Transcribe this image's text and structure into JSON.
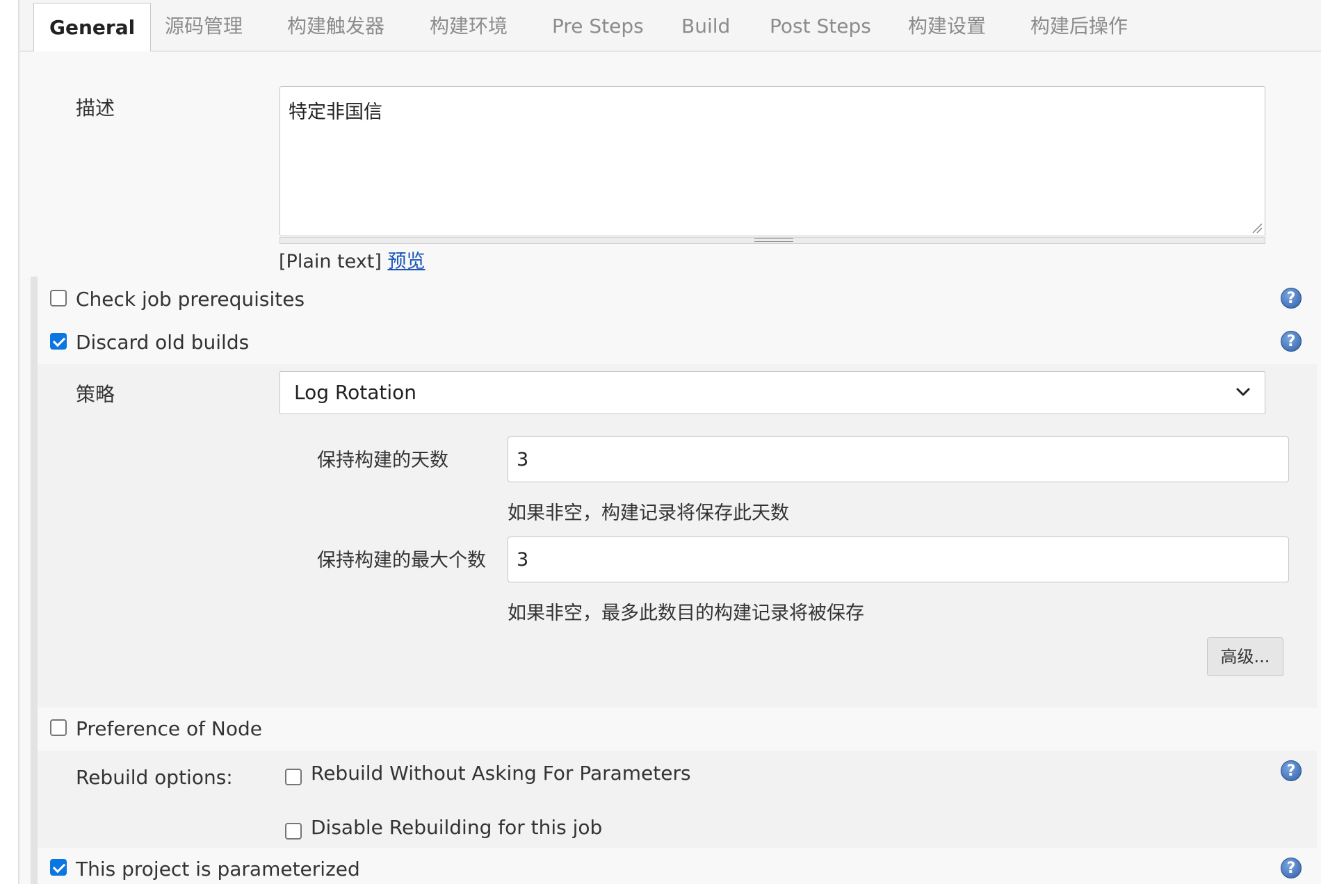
{
  "tabs": [
    {
      "label": "General"
    },
    {
      "label": "源码管理"
    },
    {
      "label": "构建触发器"
    },
    {
      "label": "构建环境"
    },
    {
      "label": "Pre Steps"
    },
    {
      "label": "Build"
    },
    {
      "label": "Post Steps"
    },
    {
      "label": "构建设置"
    },
    {
      "label": "构建后操作"
    }
  ],
  "description": {
    "label": "描述",
    "value": "特定非国信",
    "format_note": "[Plain text]",
    "preview_link": "预览"
  },
  "options": {
    "check_prereq": {
      "label": "Check job prerequisites",
      "checked": false
    },
    "discard_old": {
      "label": "Discard old builds",
      "checked": true
    }
  },
  "strategy": {
    "label": "策略",
    "selected": "Log Rotation",
    "days": {
      "label": "保持构建的天数",
      "value": "3",
      "hint": "如果非空，构建记录将保存此天数"
    },
    "max": {
      "label": "保持构建的最大个数",
      "value": "3",
      "hint": "如果非空，最多此数目的构建记录将被保存"
    },
    "advanced_label": "高级..."
  },
  "preference_node": {
    "label": "Preference of Node",
    "checked": false
  },
  "rebuild": {
    "label": "Rebuild options:",
    "without_asking": {
      "label": "Rebuild Without Asking For Parameters",
      "checked": false
    },
    "disable": {
      "label": "Disable Rebuilding for this job",
      "checked": false
    }
  },
  "parameterized": {
    "label": "This project is parameterized",
    "checked": true
  },
  "colors": {
    "accent": "#0b75e1",
    "link": "#1a56b8"
  }
}
